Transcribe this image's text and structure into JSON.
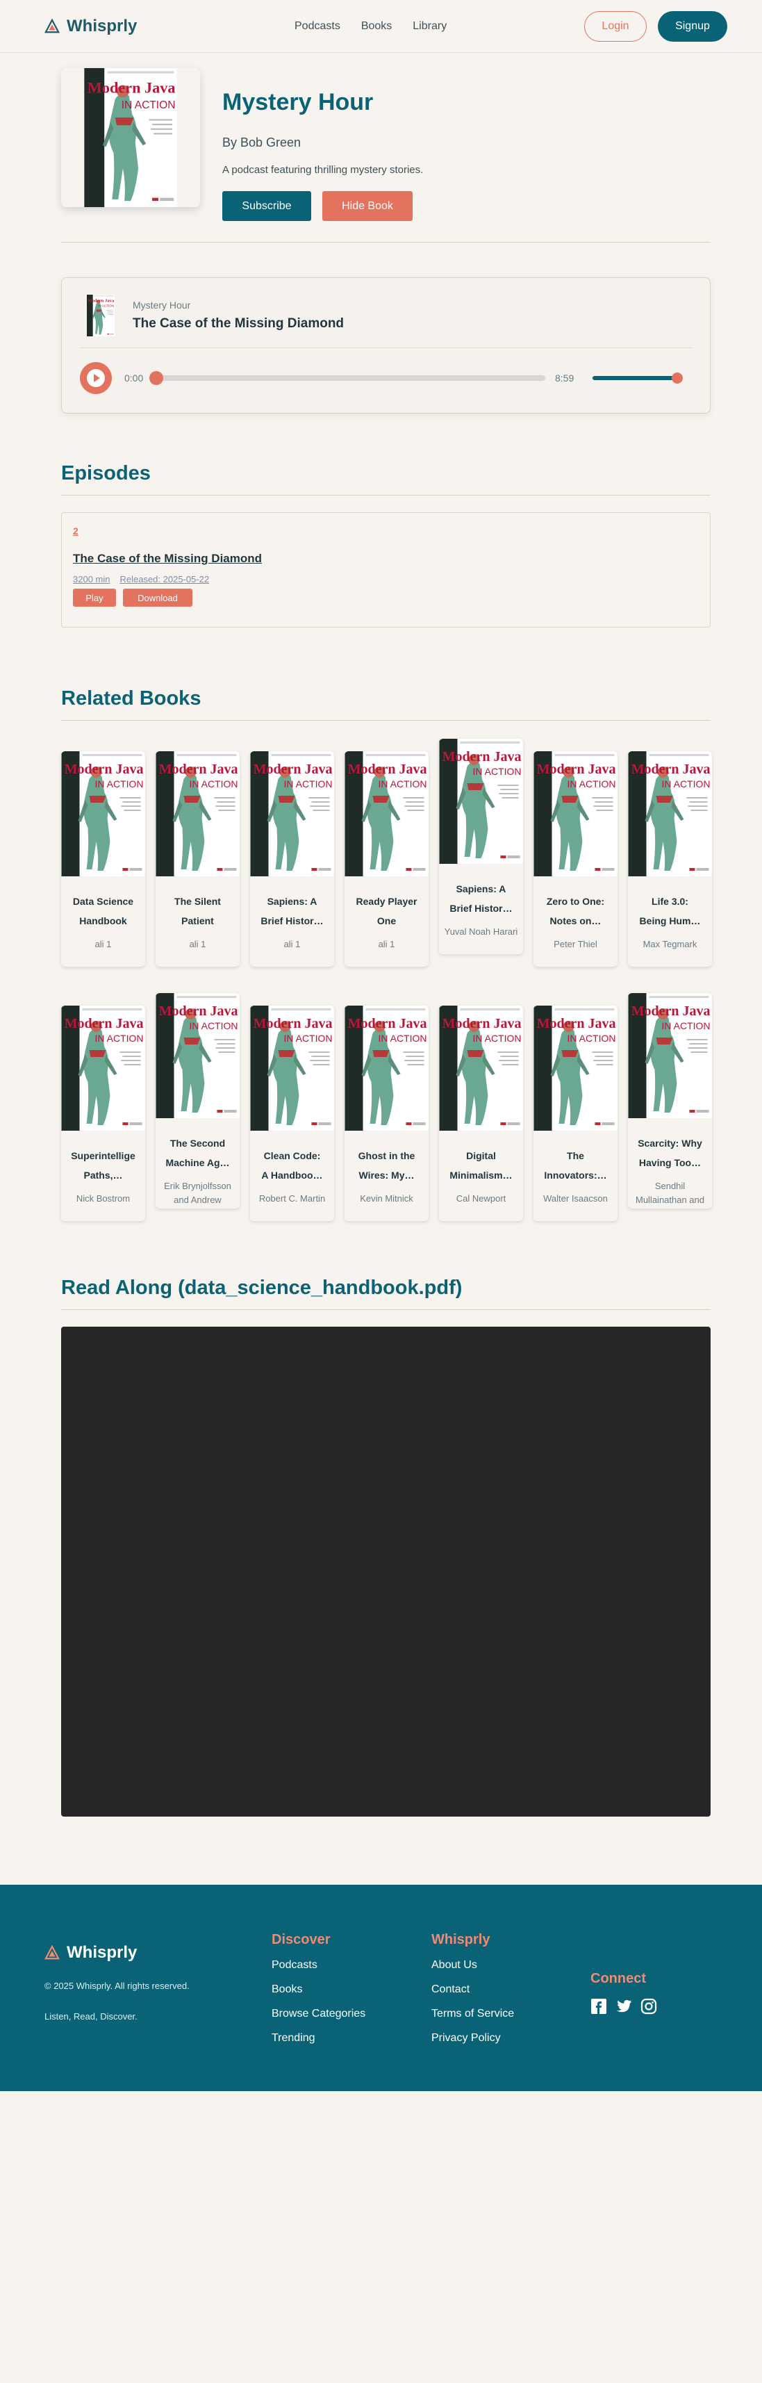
{
  "nav": {
    "brand": "Whisprly",
    "links": [
      "Podcasts",
      "Books",
      "Library"
    ],
    "login": "Login",
    "signup": "Signup"
  },
  "hero": {
    "title": "Mystery Hour",
    "author": "By Bob Green",
    "description": "A podcast featuring thrilling mystery stories.",
    "subscribe": "Subscribe",
    "hide_book": "Hide Book",
    "cover_text": {
      "line1": "Modern Java",
      "line2": "IN ACTION"
    }
  },
  "player": {
    "show": "Mystery Hour",
    "episode": "The Case of the Missing Diamond",
    "current_time": "0:00",
    "duration": "8:59",
    "progress": 0,
    "volume": 1
  },
  "episodes": {
    "title": "Episodes",
    "items": [
      {
        "number": "2",
        "title": "The Case of the Missing Diamond",
        "duration": "3200 min",
        "released": "Released: 2025-05-22",
        "play": "Play",
        "download": "Download"
      }
    ]
  },
  "related": {
    "title": "Related Books",
    "books": [
      {
        "title1": "Data Science",
        "title2": "Handbook",
        "author": "ali 1"
      },
      {
        "title1": "The Silent",
        "title2": "Patient",
        "author": "ali 1"
      },
      {
        "title1": "Sapiens: A",
        "title2": "Brief Histor…",
        "author": "ali 1"
      },
      {
        "title1": "Ready Player",
        "title2": "One",
        "author": "ali 1"
      },
      {
        "title1": "Sapiens: A",
        "title2": "Brief Histor…",
        "author": "Yuval Noah Harari"
      },
      {
        "title1": "Zero to One:",
        "title2": "Notes on…",
        "author": "Peter Thiel"
      },
      {
        "title1": "Life 3.0:",
        "title2": "Being Hum…",
        "author": "Max Tegmark"
      },
      {
        "title1": "Superintellige",
        "title2": "Paths,…",
        "author": "Nick Bostrom"
      },
      {
        "title1": "The Second",
        "title2": "Machine Ag…",
        "author": "Erik Brynjolfsson and Andrew McAfee"
      },
      {
        "title1": "Clean Code:",
        "title2": "A Handboo…",
        "author": "Robert C. Martin"
      },
      {
        "title1": "Ghost in the",
        "title2": "Wires: My…",
        "author": "Kevin Mitnick"
      },
      {
        "title1": "Digital",
        "title2": "Minimalism…",
        "author": "Cal Newport"
      },
      {
        "title1": "The",
        "title2": "Innovators:…",
        "author": "Walter Isaacson"
      },
      {
        "title1": "Scarcity: Why",
        "title2": "Having Too…",
        "author": "Sendhil Mullainathan and Eldar Shafir"
      }
    ]
  },
  "readalong": {
    "title": "Read Along (data_science_handbook.pdf)"
  },
  "footer": {
    "brand": "Whisprly",
    "copyright": "© 2025 Whisprly. All rights reserved.",
    "tagline": "Listen, Read, Discover.",
    "discover": {
      "title": "Discover",
      "links": [
        "Podcasts",
        "Books",
        "Browse Categories",
        "Trending"
      ]
    },
    "whisprly": {
      "title": "Whisprly",
      "links": [
        "About Us",
        "Contact",
        "Terms of Service",
        "Privacy Policy"
      ]
    },
    "connect": {
      "title": "Connect",
      "icons": [
        "facebook-icon",
        "twitter-icon",
        "instagram-icon"
      ]
    }
  },
  "colors": {
    "primary": "#0a6276",
    "accent": "#e3735e",
    "background": "#f7f4ef"
  }
}
